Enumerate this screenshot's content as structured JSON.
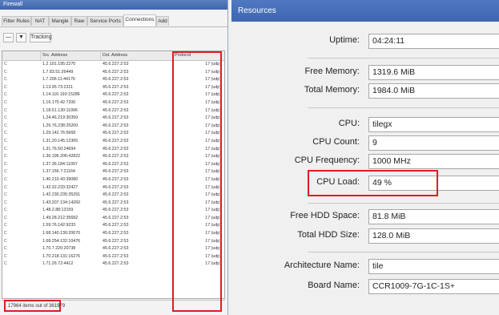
{
  "firewall": {
    "title": "Firewall",
    "tabs": [
      "Filter Rules",
      "NAT",
      "Mangle",
      "Raw",
      "Service Ports",
      "Connections",
      "Add"
    ],
    "active_tab": "Connections",
    "toolbar": {
      "minus": "—",
      "filter": "▼",
      "tracking": "Tracking"
    },
    "columns": [
      "",
      "Src. Address",
      "Dst. Address",
      "Protocol"
    ],
    "rows": [
      {
        "flag": "C",
        "src": "1.2.101.195:2270",
        "dst": "45.6.227.2:53",
        "proto": "17 (udp)"
      },
      {
        "flag": "C",
        "src": "1.7.83.51:26449",
        "dst": "45.6.227.2:53",
        "proto": "17 (udp)"
      },
      {
        "flag": "C",
        "src": "1.7.206.11:44176",
        "dst": "45.6.227.2:53",
        "proto": "17 (udp)"
      },
      {
        "flag": "C",
        "src": "1.13.95.73:2311",
        "dst": "45.6.227.2:53",
        "proto": "17 (udp)"
      },
      {
        "flag": "C",
        "src": "1.14.116.193:15286",
        "dst": "45.6.227.2:53",
        "proto": "17 (udp)"
      },
      {
        "flag": "C",
        "src": "1.16.170.42:7200",
        "dst": "45.6.227.2:53",
        "proto": "17 (udp)"
      },
      {
        "flag": "C",
        "src": "1.18.51.130:11996",
        "dst": "45.6.227.2:53",
        "proto": "17 (udp)"
      },
      {
        "flag": "C",
        "src": "1.24.46.219:30350",
        "dst": "45.6.227.2:53",
        "proto": "17 (udp)"
      },
      {
        "flag": "C",
        "src": "1.26.76.238:25200",
        "dst": "45.6.227.2:53",
        "proto": "17 (udp)"
      },
      {
        "flag": "C",
        "src": "1.29.142.76:5668",
        "dst": "45.6.227.2:53",
        "proto": "17 (udp)"
      },
      {
        "flag": "C",
        "src": "1.31.20.145:12365",
        "dst": "45.6.227.2:53",
        "proto": "17 (udp)"
      },
      {
        "flag": "C",
        "src": "1.31.76.50:24694",
        "dst": "45.6.227.2:53",
        "proto": "17 (udp)"
      },
      {
        "flag": "C",
        "src": "1.36.196.206:42822",
        "dst": "45.6.227.2:53",
        "proto": "17 (udp)"
      },
      {
        "flag": "C",
        "src": "1.37.36.184:11097",
        "dst": "45.6.227.2:53",
        "proto": "17 (udp)"
      },
      {
        "flag": "C",
        "src": "1.37.156.7:21164",
        "dst": "45.6.227.2:53",
        "proto": "17 (udp)"
      },
      {
        "flag": "C",
        "src": "1.40.210.43:39080",
        "dst": "45.6.227.2:53",
        "proto": "17 (udp)"
      },
      {
        "flag": "C",
        "src": "1.42.32.233:32427",
        "dst": "45.6.227.2:53",
        "proto": "17 (udp)"
      },
      {
        "flag": "C",
        "src": "1.42.230.235:35291",
        "dst": "45.6.227.2:53",
        "proto": "17 (udp)"
      },
      {
        "flag": "C",
        "src": "1.43.207.134:14260",
        "dst": "45.6.227.2:53",
        "proto": "17 (udp)"
      },
      {
        "flag": "C",
        "src": "1.48.2.88:13159",
        "dst": "45.6.227.2:53",
        "proto": "17 (udp)"
      },
      {
        "flag": "C",
        "src": "1.49.28.212:35682",
        "dst": "45.6.227.2:53",
        "proto": "17 (udp)"
      },
      {
        "flag": "C",
        "src": "1.59.76.142:9233",
        "dst": "45.6.227.2:53",
        "proto": "17 (udp)"
      },
      {
        "flag": "C",
        "src": "1.68.140.130:20670",
        "dst": "45.6.227.2:53",
        "proto": "17 (udp)"
      },
      {
        "flag": "C",
        "src": "1.68.254.132:10476",
        "dst": "45.6.227.2:53",
        "proto": "17 (udp)"
      },
      {
        "flag": "C",
        "src": "1.70.7.220:20738",
        "dst": "45.6.227.2:53",
        "proto": "17 (udp)"
      },
      {
        "flag": "C",
        "src": "1.70.218.131:16276",
        "dst": "45.6.227.2:53",
        "proto": "17 (udp)"
      },
      {
        "flag": "C",
        "src": "1.71.26.72:4412",
        "dst": "45.6.227.2:53",
        "proto": "17 (udp)"
      }
    ],
    "status": "17964 items out of 361979"
  },
  "resources": {
    "title": "Resources",
    "fields": [
      {
        "label": "Uptime:",
        "value": "04:24:11"
      },
      {
        "label": "Free Memory:",
        "value": "1319.6 MiB"
      },
      {
        "label": "Total Memory:",
        "value": "1984.0 MiB"
      },
      {
        "label": "CPU:",
        "value": "tilegx"
      },
      {
        "label": "CPU Count:",
        "value": "9"
      },
      {
        "label": "CPU Frequency:",
        "value": "1000 MHz"
      },
      {
        "label": "CPU Load:",
        "value": "49 %"
      },
      {
        "label": "Free HDD Space:",
        "value": "81.8 MiB"
      },
      {
        "label": "Total HDD Size:",
        "value": "128.0 MiB"
      },
      {
        "label": "Architecture Name:",
        "value": "tile"
      },
      {
        "label": "Board Name:",
        "value": "CCR1009-7G-1C-1S+"
      }
    ]
  },
  "colors": {
    "titlebar": "#4a72ba",
    "highlight": "#e01b24"
  }
}
